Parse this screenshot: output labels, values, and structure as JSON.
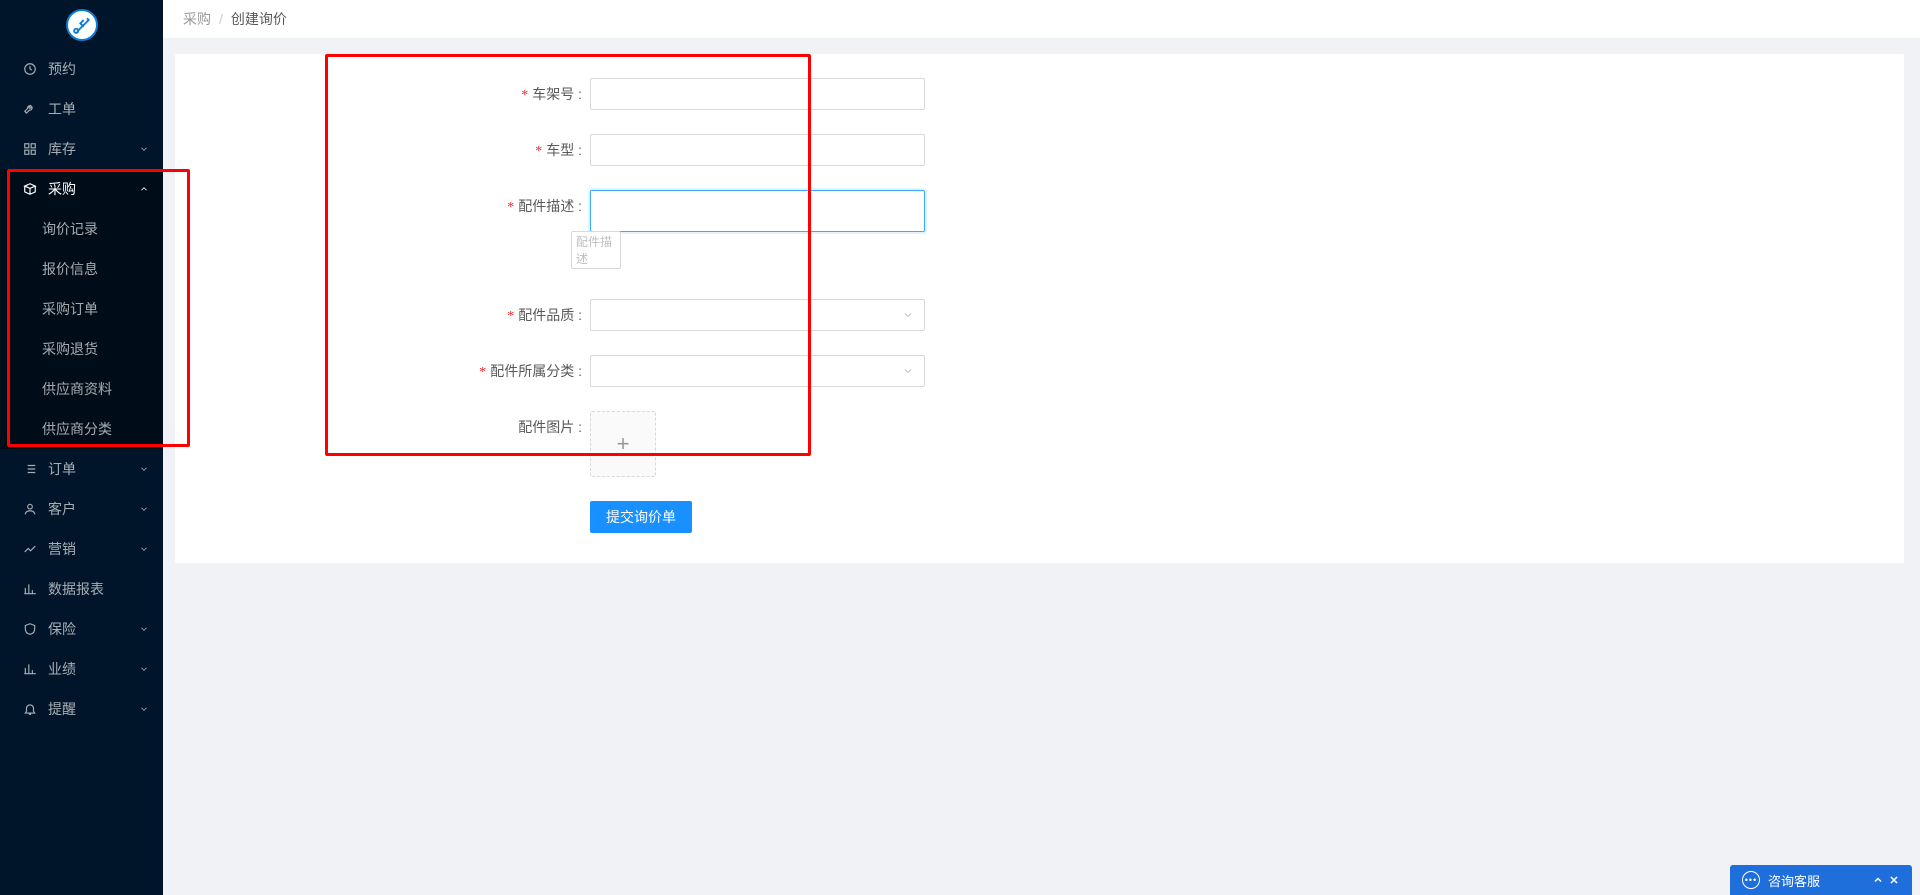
{
  "breadcrumb": {
    "parent": "采购",
    "current": "创建询价"
  },
  "sidebar": {
    "items": [
      {
        "label": "预约",
        "icon": "clock"
      },
      {
        "label": "工单",
        "icon": "wrench"
      },
      {
        "label": "库存",
        "icon": "grid",
        "expandable": true
      },
      {
        "label": "采购",
        "icon": "package",
        "open": true,
        "children": [
          {
            "label": "询价记录"
          },
          {
            "label": "报价信息"
          },
          {
            "label": "采购订单"
          },
          {
            "label": "采购退货"
          },
          {
            "label": "供应商资料"
          },
          {
            "label": "供应商分类"
          }
        ]
      },
      {
        "label": "订单",
        "icon": "list",
        "expandable": true
      },
      {
        "label": "客户",
        "icon": "user",
        "expandable": true
      },
      {
        "label": "营销",
        "icon": "trend",
        "expandable": true
      },
      {
        "label": "数据报表",
        "icon": "chart"
      },
      {
        "label": "保险",
        "icon": "shield",
        "expandable": true
      },
      {
        "label": "业绩",
        "icon": "chart",
        "expandable": true
      },
      {
        "label": "提醒",
        "icon": "bell",
        "expandable": true
      }
    ]
  },
  "form": {
    "vin_label": "车架号 :",
    "model_label": "车型 :",
    "desc_label": "配件描述 :",
    "desc_hint": "配件描述",
    "quality_label": "配件品质 :",
    "category_label": "配件所属分类 :",
    "image_label": "配件图片 :",
    "submit": "提交询价单"
  },
  "chat": {
    "label": "咨询客服"
  }
}
